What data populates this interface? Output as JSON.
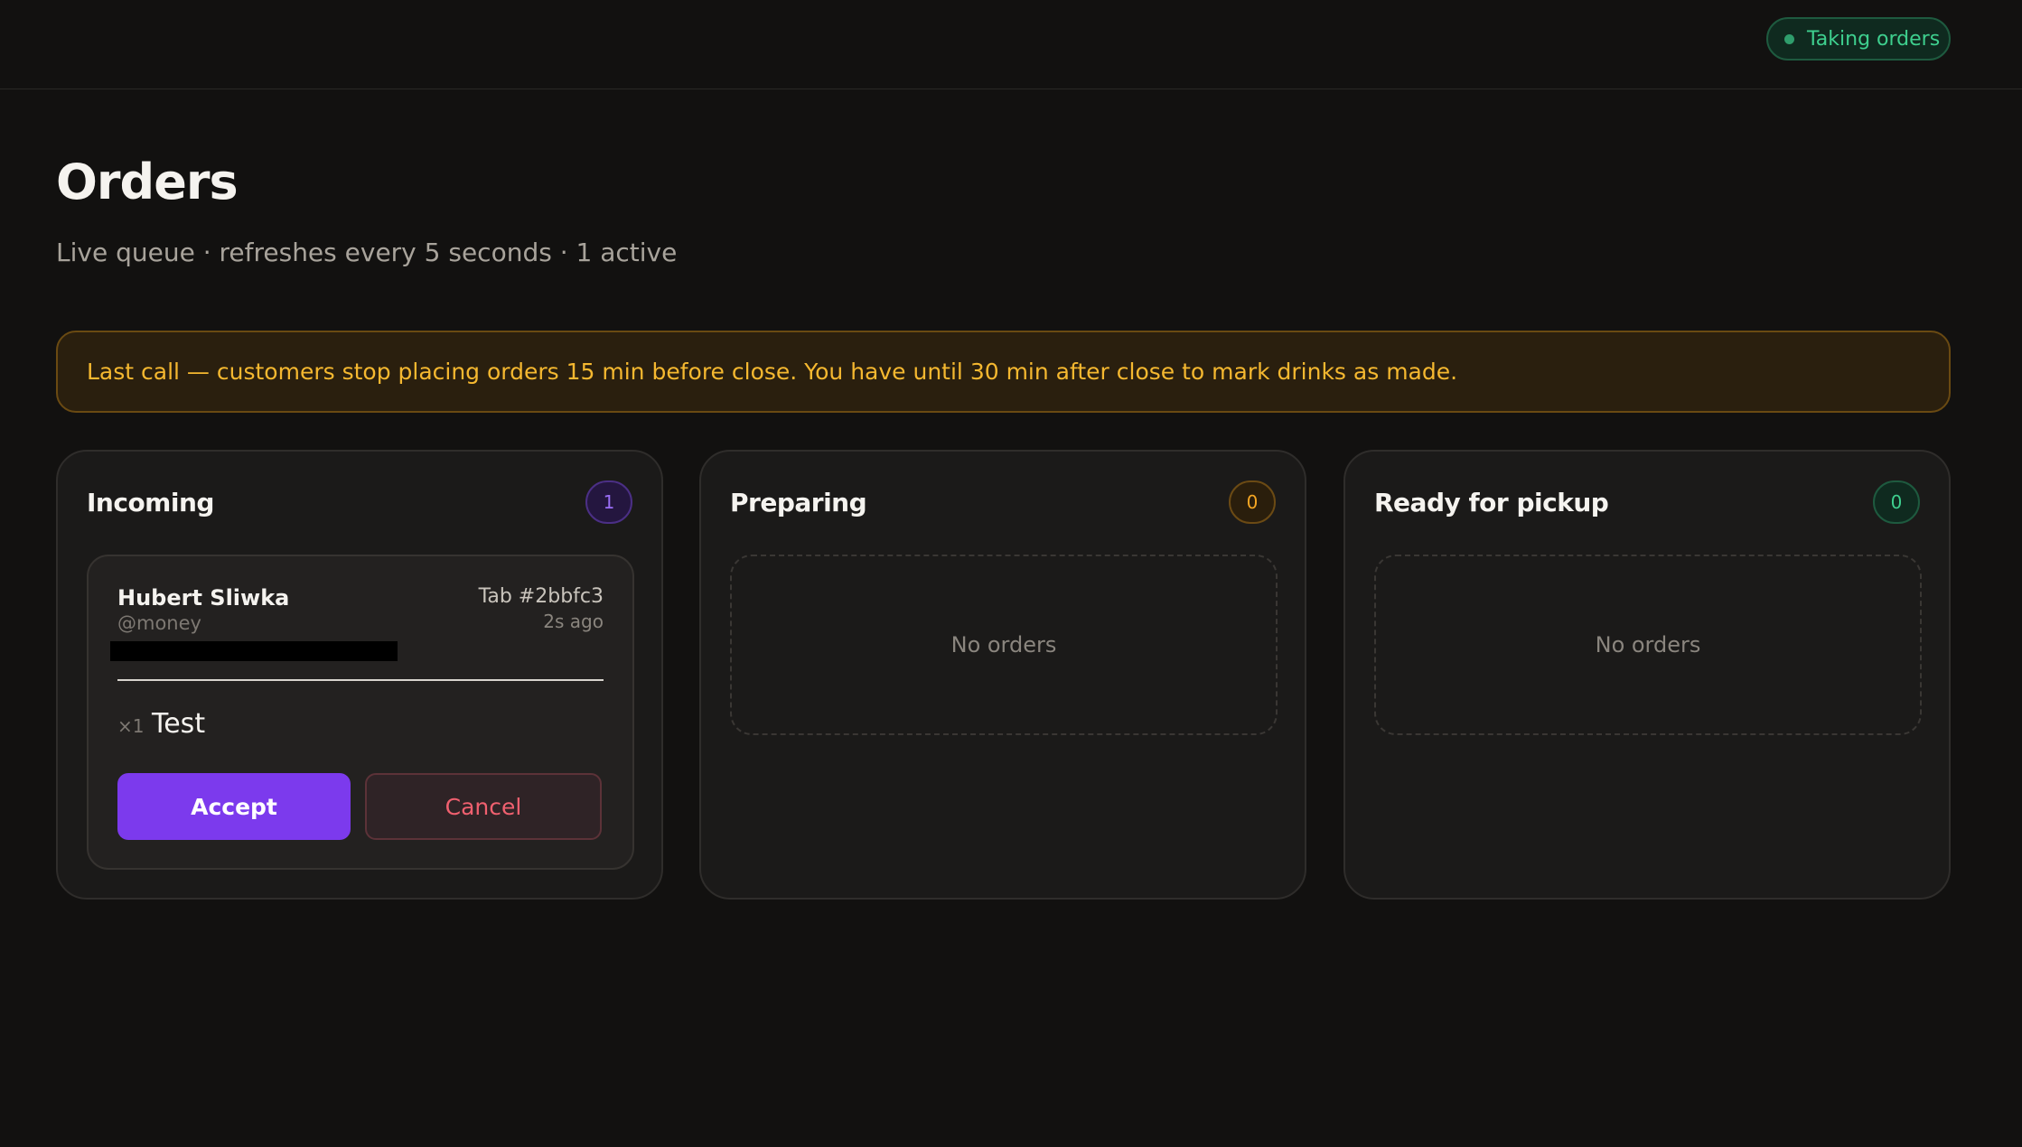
{
  "header": {
    "status_label": "Taking orders"
  },
  "page": {
    "title": "Orders",
    "subtitle": "Live queue · refreshes every 5 seconds · 1 active"
  },
  "banner": {
    "text": "Last call — customers stop placing orders 15 min before close. You have until 30 min after close to mark drinks as made."
  },
  "columns": [
    {
      "title": "Incoming",
      "count": "1"
    },
    {
      "title": "Preparing",
      "count": "0",
      "empty_text": "No orders"
    },
    {
      "title": "Ready for pickup",
      "count": "0",
      "empty_text": "No orders"
    }
  ],
  "order": {
    "customer_name": "Hubert Sliwka",
    "handle": "@money",
    "tab": "Tab #2bbfc3",
    "time_ago": "2s ago",
    "items": [
      {
        "qty": "×1",
        "name": "Test"
      }
    ],
    "accept_label": "Accept",
    "cancel_label": "Cancel"
  },
  "colors": {
    "accent": "#7c3aed",
    "status_green": "#3ecf8e",
    "warning": "#f5b830",
    "danger": "#f0606f"
  }
}
